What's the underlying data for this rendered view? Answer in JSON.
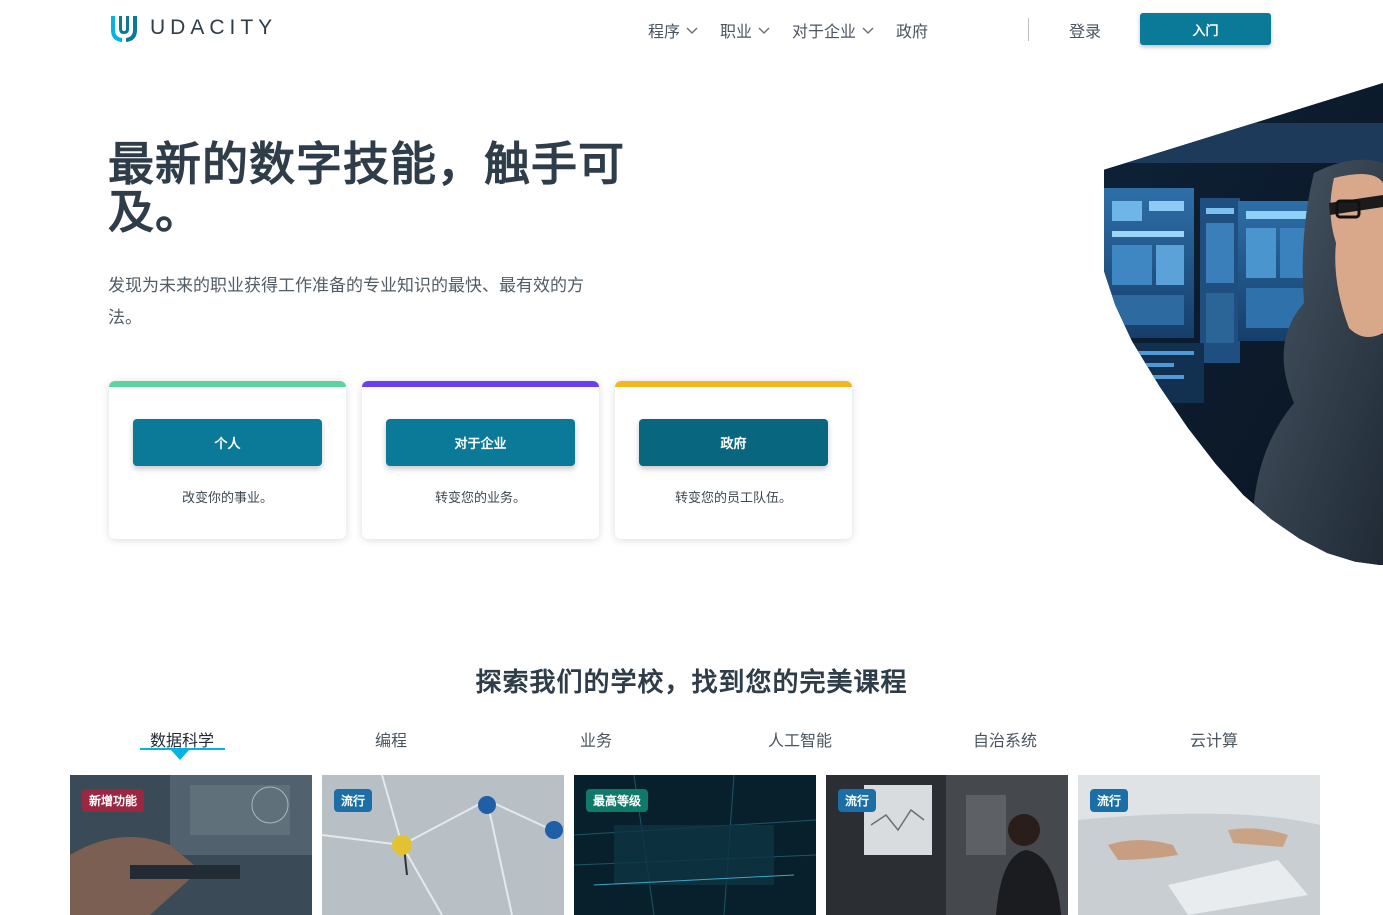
{
  "header": {
    "logo_text": "UDACITY",
    "nav": [
      {
        "label": "程序",
        "has_dropdown": true
      },
      {
        "label": "职业",
        "has_dropdown": true
      },
      {
        "label": "对于企业",
        "has_dropdown": true
      },
      {
        "label": "政府",
        "has_dropdown": false
      }
    ],
    "login_label": "登录",
    "cta_label": "入门"
  },
  "hero": {
    "title": "最新的数字技能，触手可及。",
    "subtitle": "发现为未来的职业获得工作准备的专业知识的最快、最有效的方法。"
  },
  "cards": [
    {
      "button": "个人",
      "desc": "改变你的事业。",
      "accent": "#5dd39e"
    },
    {
      "button": "对于企业",
      "desc": "转变您的业务。",
      "accent": "#6b3ef3"
    },
    {
      "button": "政府",
      "desc": "转变您的员工队伍。",
      "accent": "#f5b61c"
    }
  ],
  "explore": {
    "title": "探索我们的学校，找到您的完美课程",
    "tabs": [
      "数据科学",
      "编程",
      "业务",
      "人工智能",
      "自治系统",
      "云计算"
    ],
    "active_tab": "数据科学"
  },
  "schools": [
    {
      "badge": "新增功能",
      "badge_color": "#9b2742"
    },
    {
      "badge": "流行",
      "badge_color": "#1b6fa6"
    },
    {
      "badge": "最高等级",
      "badge_color": "#0f7a6a"
    },
    {
      "badge": "流行",
      "badge_color": "#1b6fa6"
    },
    {
      "badge": "流行",
      "badge_color": "#1b6fa6"
    }
  ],
  "colors": {
    "brand": "#0b7a99",
    "brand_dark": "#08677f",
    "text": "#2e3d49",
    "tab_accent": "#02b3e4"
  },
  "icons": [
    "udacity-logo-icon",
    "chevron-down-icon"
  ]
}
